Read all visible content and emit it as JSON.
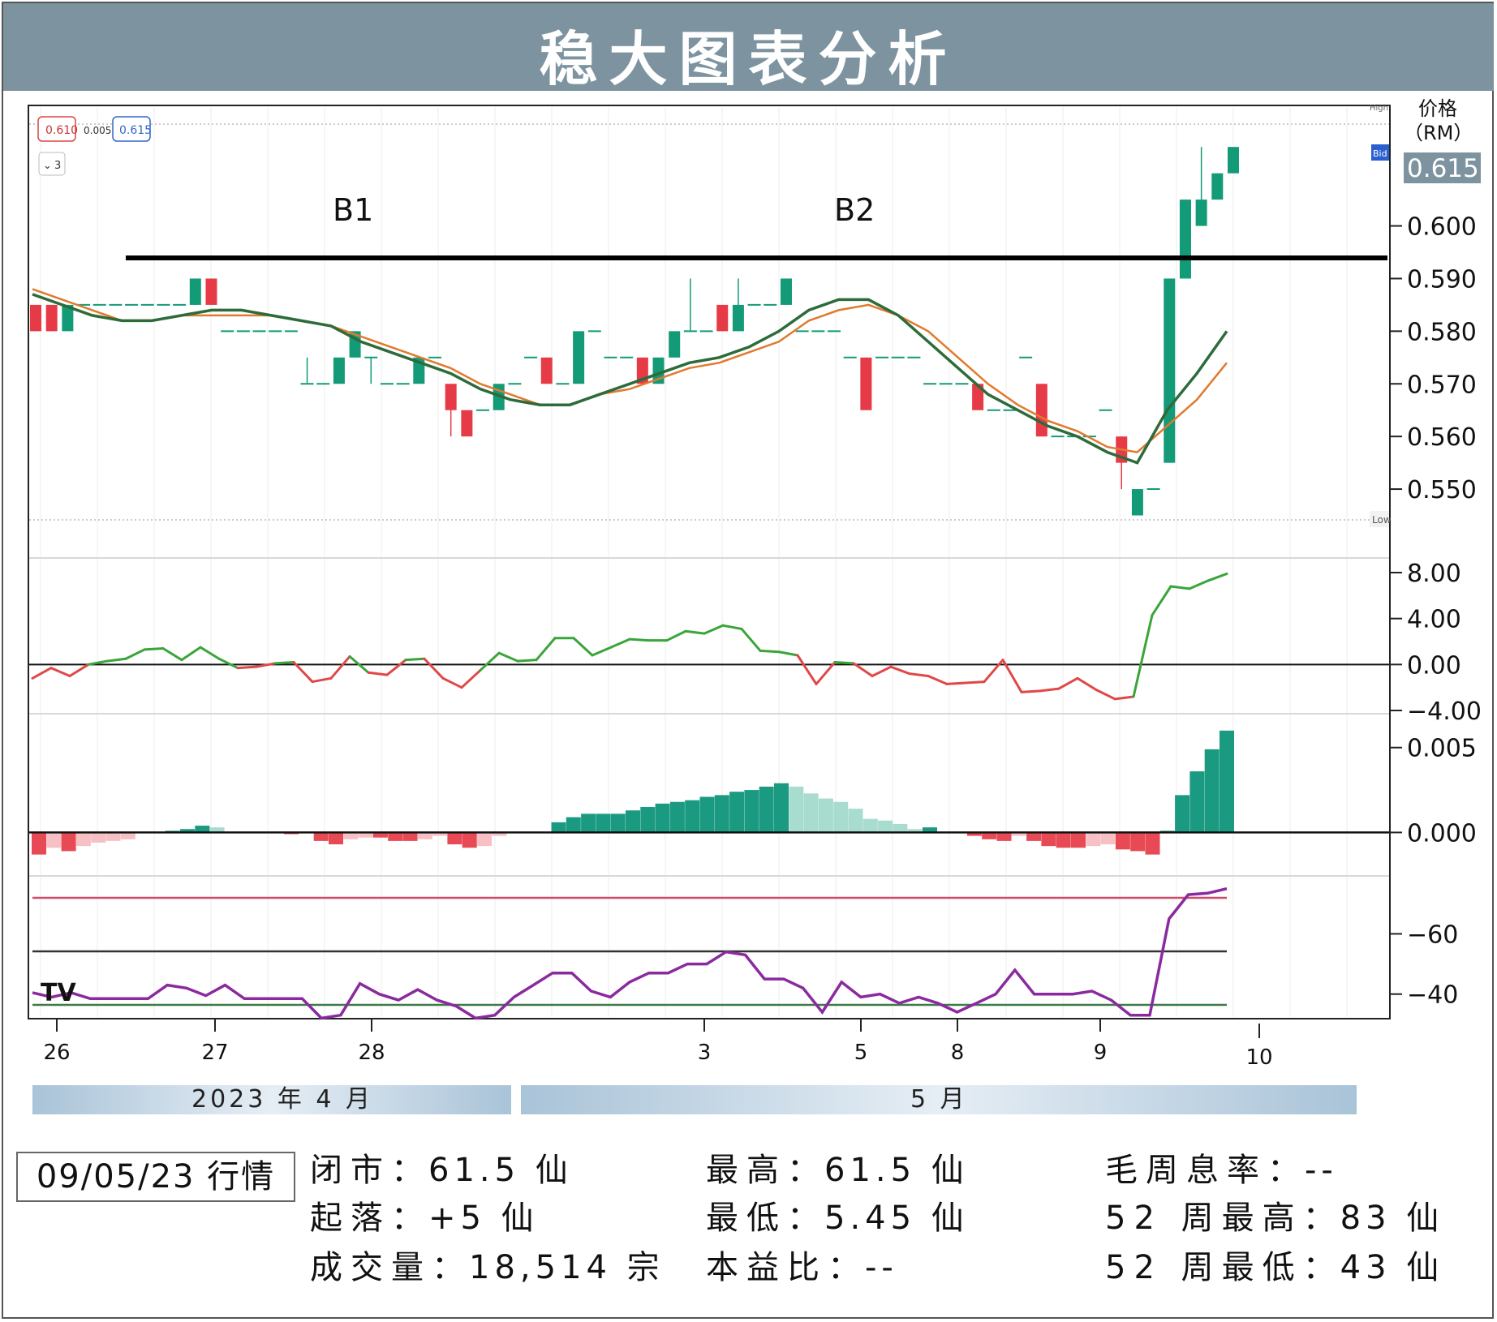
{
  "title": "稳大图表分析",
  "unit_label_line1": "价格",
  "unit_label_line2": "（RM）",
  "last_price": "0.615",
  "toolbar": {
    "v1": "0.610",
    "v2": "0.005",
    "v3": "0.615",
    "interval": "3"
  },
  "chart_tags": {
    "high": "High",
    "low": "Low",
    "bid": "Bid"
  },
  "logo_text": "TV",
  "x_ticks": [
    "26",
    "27",
    "28",
    "3",
    "5",
    "8",
    "9",
    "10"
  ],
  "month_bands": {
    "april": "2023 年 4 月",
    "may": "5 月"
  },
  "chart_data": [
    {
      "type": "candlestick",
      "yticks": [
        "0.600",
        "0.590",
        "0.580",
        "0.570",
        "0.560",
        "0.550"
      ],
      "ylim": [
        0.544,
        0.6195
      ],
      "resistance_level": 0.59,
      "annotations": [
        "B1",
        "B2"
      ],
      "candles": [
        [
          0.585,
          0.585,
          0.58,
          0.58
        ],
        [
          0.585,
          0.585,
          0.58,
          0.58
        ],
        [
          0.58,
          0.585,
          0.58,
          0.585
        ],
        [
          0.585,
          0.585,
          0.585,
          0.585
        ],
        [
          0.585,
          0.585,
          0.585,
          0.585
        ],
        [
          0.585,
          0.585,
          0.585,
          0.585
        ],
        [
          0.585,
          0.585,
          0.585,
          0.585
        ],
        [
          0.585,
          0.585,
          0.585,
          0.585
        ],
        [
          0.585,
          0.585,
          0.585,
          0.585
        ],
        [
          0.585,
          0.585,
          0.585,
          0.585
        ],
        [
          0.585,
          0.59,
          0.585,
          0.59
        ],
        [
          0.59,
          0.59,
          0.585,
          0.585
        ],
        [
          0.58,
          0.58,
          0.58,
          0.58
        ],
        [
          0.58,
          0.58,
          0.58,
          0.58
        ],
        [
          0.58,
          0.58,
          0.58,
          0.58
        ],
        [
          0.58,
          0.58,
          0.58,
          0.58
        ],
        [
          0.58,
          0.58,
          0.58,
          0.58
        ],
        [
          0.57,
          0.575,
          0.57,
          0.57
        ],
        [
          0.57,
          0.57,
          0.57,
          0.57
        ],
        [
          0.57,
          0.575,
          0.57,
          0.575
        ],
        [
          0.575,
          0.58,
          0.575,
          0.58
        ],
        [
          0.575,
          0.575,
          0.57,
          0.575
        ],
        [
          0.57,
          0.57,
          0.57,
          0.57
        ],
        [
          0.57,
          0.57,
          0.57,
          0.57
        ],
        [
          0.57,
          0.575,
          0.57,
          0.575
        ],
        [
          0.575,
          0.575,
          0.575,
          0.575
        ],
        [
          0.57,
          0.57,
          0.56,
          0.565
        ],
        [
          0.565,
          0.565,
          0.56,
          0.56
        ],
        [
          0.565,
          0.565,
          0.565,
          0.565
        ],
        [
          0.565,
          0.57,
          0.565,
          0.57
        ],
        [
          0.57,
          0.57,
          0.57,
          0.57
        ],
        [
          0.575,
          0.575,
          0.575,
          0.575
        ],
        [
          0.575,
          0.575,
          0.57,
          0.57
        ],
        [
          0.57,
          0.57,
          0.57,
          0.57
        ],
        [
          0.57,
          0.58,
          0.57,
          0.58
        ],
        [
          0.58,
          0.58,
          0.58,
          0.58
        ],
        [
          0.575,
          0.575,
          0.575,
          0.575
        ],
        [
          0.575,
          0.575,
          0.575,
          0.575
        ],
        [
          0.575,
          0.575,
          0.57,
          0.57
        ],
        [
          0.57,
          0.575,
          0.57,
          0.575
        ],
        [
          0.575,
          0.58,
          0.575,
          0.58
        ],
        [
          0.58,
          0.59,
          0.58,
          0.58
        ],
        [
          0.58,
          0.58,
          0.58,
          0.58
        ],
        [
          0.585,
          0.585,
          0.58,
          0.58
        ],
        [
          0.58,
          0.59,
          0.58,
          0.585
        ],
        [
          0.585,
          0.585,
          0.585,
          0.585
        ],
        [
          0.585,
          0.585,
          0.585,
          0.585
        ],
        [
          0.585,
          0.59,
          0.585,
          0.59
        ],
        [
          0.58,
          0.58,
          0.58,
          0.58
        ],
        [
          0.58,
          0.58,
          0.58,
          0.58
        ],
        [
          0.58,
          0.58,
          0.58,
          0.58
        ],
        [
          0.575,
          0.575,
          0.575,
          0.575
        ],
        [
          0.575,
          0.575,
          0.565,
          0.565
        ],
        [
          0.575,
          0.575,
          0.575,
          0.575
        ],
        [
          0.575,
          0.575,
          0.575,
          0.575
        ],
        [
          0.575,
          0.575,
          0.575,
          0.575
        ],
        [
          0.57,
          0.57,
          0.57,
          0.57
        ],
        [
          0.57,
          0.57,
          0.57,
          0.57
        ],
        [
          0.57,
          0.57,
          0.57,
          0.57
        ],
        [
          0.57,
          0.57,
          0.565,
          0.565
        ],
        [
          0.565,
          0.565,
          0.565,
          0.565
        ],
        [
          0.565,
          0.565,
          0.565,
          0.565
        ],
        [
          0.575,
          0.575,
          0.575,
          0.575
        ],
        [
          0.57,
          0.57,
          0.56,
          0.56
        ],
        [
          0.56,
          0.56,
          0.56,
          0.56
        ],
        [
          0.56,
          0.56,
          0.56,
          0.56
        ],
        [
          0.56,
          0.56,
          0.56,
          0.56
        ],
        [
          0.565,
          0.565,
          0.565,
          0.565
        ],
        [
          0.56,
          0.56,
          0.55,
          0.555
        ],
        [
          0.545,
          0.55,
          0.545,
          0.55
        ],
        [
          0.55,
          0.55,
          0.55,
          0.55
        ],
        [
          0.555,
          0.59,
          0.555,
          0.59
        ],
        [
          0.59,
          0.605,
          0.59,
          0.605
        ],
        [
          0.6,
          0.615,
          0.6,
          0.605
        ],
        [
          0.605,
          0.61,
          0.605,
          0.61
        ],
        [
          0.61,
          0.615,
          0.61,
          0.615
        ]
      ],
      "ma_fast": [
        0.587,
        0.585,
        0.583,
        0.582,
        0.582,
        0.583,
        0.584,
        0.584,
        0.583,
        0.582,
        0.581,
        0.578,
        0.576,
        0.574,
        0.572,
        0.569,
        0.567,
        0.566,
        0.566,
        0.568,
        0.57,
        0.572,
        0.574,
        0.575,
        0.577,
        0.58,
        0.584,
        0.586,
        0.586,
        0.583,
        0.578,
        0.573,
        0.568,
        0.565,
        0.562,
        0.56,
        0.557,
        0.555,
        0.565,
        0.572,
        0.58
      ],
      "ma_slow": [
        0.588,
        0.586,
        0.584,
        0.582,
        0.582,
        0.583,
        0.583,
        0.583,
        0.583,
        0.582,
        0.581,
        0.579,
        0.577,
        0.575,
        0.573,
        0.57,
        0.568,
        0.566,
        0.566,
        0.568,
        0.569,
        0.571,
        0.573,
        0.574,
        0.576,
        0.578,
        0.582,
        0.584,
        0.585,
        0.583,
        0.58,
        0.575,
        0.57,
        0.566,
        0.563,
        0.561,
        0.558,
        0.557,
        0.562,
        0.567,
        0.574
      ]
    },
    {
      "type": "line",
      "yticks": [
        "8.00",
        "4.00",
        "0.00",
        "−4.00"
      ],
      "ylim": [
        -4.0,
        8.0
      ],
      "values": [
        -1.2,
        -0.3,
        -1.0,
        0.0,
        0.3,
        0.5,
        1.3,
        1.4,
        0.4,
        1.5,
        0.5,
        -0.3,
        -0.2,
        0.1,
        0.2,
        -1.5,
        -1.2,
        0.7,
        -0.7,
        -0.9,
        0.4,
        0.5,
        -1.2,
        -2.0,
        -0.5,
        1.0,
        0.3,
        0.4,
        2.3,
        2.3,
        0.8,
        1.5,
        2.2,
        2.1,
        2.1,
        2.9,
        2.7,
        3.4,
        3.1,
        1.2,
        1.1,
        0.8,
        -1.7,
        0.2,
        0.1,
        -1.0,
        -0.2,
        -0.8,
        -1.0,
        -1.7,
        -1.6,
        -1.5,
        0.4,
        -2.4,
        -2.3,
        -2.1,
        -1.2,
        -2.2,
        -3.0,
        -2.8,
        4.3,
        6.8,
        6.6,
        7.3,
        7.9
      ]
    },
    {
      "type": "bar",
      "yticks": [
        "0.005",
        "0.000"
      ],
      "ylim": [
        -0.0017,
        0.0058
      ],
      "values": [
        -0.0013,
        -0.0009,
        -0.0011,
        -0.0008,
        -0.0006,
        -0.0005,
        -0.0004,
        0.0,
        0.0,
        0.0001,
        0.0002,
        0.0004,
        0.0003,
        0.0,
        0.0,
        0.0,
        0.0,
        -0.0001,
        0.0,
        -0.0005,
        -0.0007,
        -0.0004,
        -0.0003,
        -0.0003,
        -0.0005,
        -0.0005,
        -0.0004,
        -0.0002,
        -0.0007,
        -0.0009,
        -0.0008,
        -0.0002,
        0.0,
        0.0,
        0.0,
        0.0006,
        0.0009,
        0.0011,
        0.0011,
        0.0011,
        0.0013,
        0.0015,
        0.0017,
        0.0018,
        0.0019,
        0.0021,
        0.0022,
        0.0024,
        0.0025,
        0.0027,
        0.0029,
        0.0027,
        0.0023,
        0.002,
        0.0018,
        0.0014,
        0.0008,
        0.0007,
        0.0005,
        0.0002,
        0.0003,
        0.0,
        0.0,
        -0.0002,
        -0.0004,
        -0.0005,
        -0.0002,
        -0.0005,
        -0.0008,
        -0.0009,
        -0.0009,
        -0.0008,
        -0.0007,
        -0.001,
        -0.0011,
        -0.0013,
        0.0001,
        0.0022,
        0.0036,
        0.0049,
        0.006
      ]
    },
    {
      "type": "line",
      "yticks": [
        "−60",
        "−40"
      ],
      "ylim": [
        -34,
        -76
      ],
      "levels": [
        -80,
        -50,
        -20
      ],
      "values": [
        -40.5,
        -39.0,
        -40.5,
        -38.5,
        -38.5,
        -38.5,
        -38.5,
        -43.0,
        -42.0,
        -39.5,
        -43.0,
        -38.5,
        -38.5,
        -38.5,
        -38.5,
        -32.0,
        -33.0,
        -43.5,
        -40.0,
        -38.0,
        -41.5,
        -38.0,
        -36.0,
        -32.0,
        -33.0,
        -39.0,
        -43.0,
        -47.0,
        -47.0,
        -41.0,
        -39.0,
        -44.0,
        -47.0,
        -47.0,
        -50.0,
        -50.0,
        -54.0,
        -53.0,
        -45.0,
        -45.0,
        -42.0,
        -34.0,
        -44.0,
        -39.0,
        -40.0,
        -37.0,
        -39.0,
        -37.0,
        -34.0,
        -37.0,
        -40.0,
        -48.0,
        -40.0,
        -40.0,
        -40.0,
        -41.0,
        -38.0,
        -33.0,
        -33.0,
        -65.0,
        -73.0,
        -73.5,
        -75.0
      ]
    }
  ],
  "footer": {
    "date_label": "09/05/23 行情",
    "close_label": "闭市",
    "close_value": "61.5 仙",
    "change_label": "起落",
    "change_value": "+5 仙",
    "volume_label": "成交量",
    "volume_value": "18,514 宗",
    "high_label": "最高",
    "high_value": "61.5 仙",
    "low_label": "最低",
    "low_value": "5.45 仙",
    "pe_label": "本益比",
    "pe_value": "--",
    "dy_label": "毛周息率",
    "dy_value": "--",
    "w52_high_label": "52 周最高",
    "w52_high_value": "83 仙",
    "w52_low_label": "52 周最低",
    "w52_low_value": "43 仙",
    "sep": "："
  },
  "colors": {
    "up": "#139a77",
    "down": "#e63b47",
    "title_bg": "#7d939f",
    "ma_fast": "#2e6b3a",
    "ma_slow": "#e07a2e",
    "osc_pos": "#3aa53a",
    "osc_neg": "#e04848",
    "wr_line": "#8a2a9e"
  }
}
